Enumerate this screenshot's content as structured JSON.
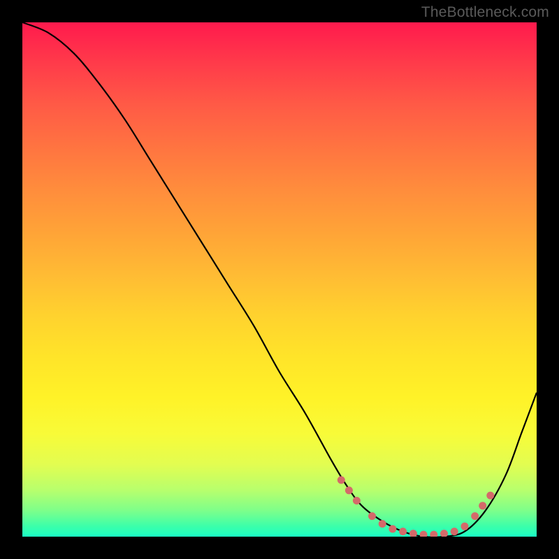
{
  "watermark": "TheBottleneck.com",
  "chart_data": {
    "type": "line",
    "title": "",
    "xlabel": "",
    "ylabel": "",
    "xlim": [
      0,
      100
    ],
    "ylim": [
      0,
      100
    ],
    "series": [
      {
        "name": "curve",
        "x": [
          0,
          5,
          10,
          15,
          20,
          25,
          30,
          35,
          40,
          45,
          50,
          55,
          60,
          63,
          66,
          70,
          74,
          78,
          82,
          86,
          90,
          94,
          97,
          100
        ],
        "y": [
          100,
          98,
          94,
          88,
          81,
          73,
          65,
          57,
          49,
          41,
          32,
          24,
          15,
          10,
          6,
          3,
          1,
          0,
          0,
          1,
          5,
          12,
          20,
          28
        ]
      }
    ],
    "markers": {
      "name": "highlight-points",
      "x": [
        62,
        63.5,
        65,
        68,
        70,
        72,
        74,
        76,
        78,
        80,
        82,
        84,
        86,
        88,
        89.5,
        91
      ],
      "y": [
        11,
        9,
        7,
        4,
        2.5,
        1.5,
        1,
        0.6,
        0.4,
        0.4,
        0.6,
        1,
        2,
        4,
        6,
        8
      ]
    }
  }
}
